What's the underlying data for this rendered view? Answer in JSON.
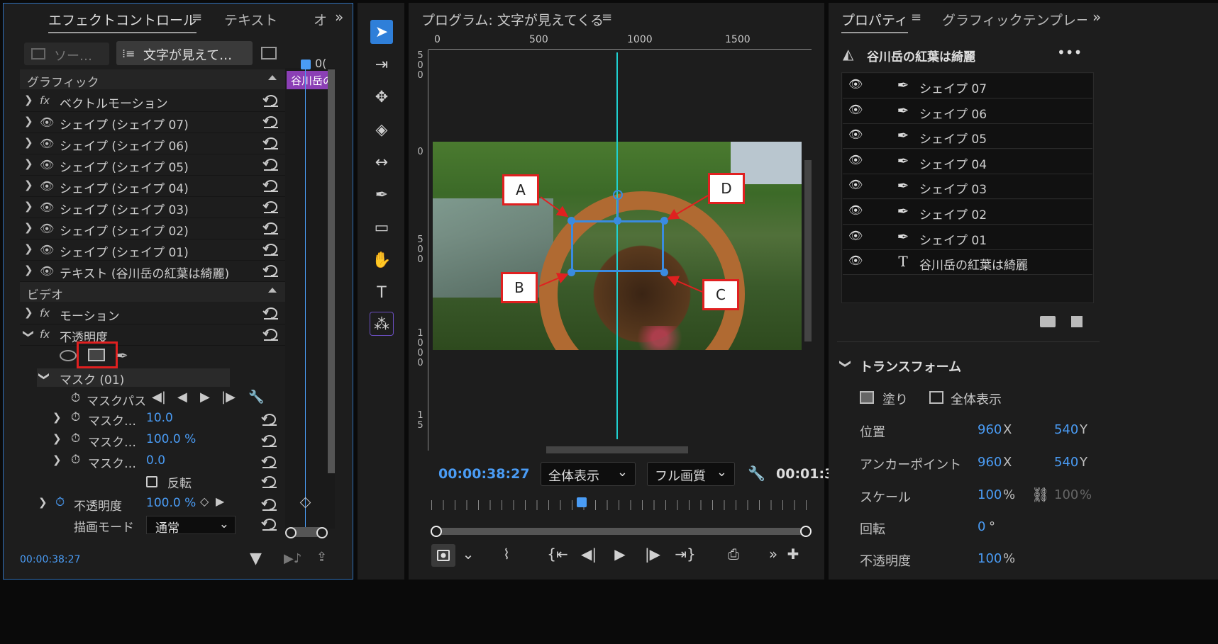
{
  "effect_controls": {
    "tabs": [
      "エフェクトコントロール",
      "テキスト",
      "オ"
    ],
    "source_label": "ソー…",
    "sequence_label": "文字が見えて…",
    "timeline_time": "0(",
    "clip_label": "谷川岳の",
    "section_graphic": "グラフィック",
    "graphic_rows": [
      {
        "icon": "fx",
        "label": "ベクトルモーション"
      },
      {
        "icon": "eye",
        "label": "シェイプ (シェイプ 07)"
      },
      {
        "icon": "eye",
        "label": "シェイプ (シェイプ 06)"
      },
      {
        "icon": "eye",
        "label": "シェイプ (シェイプ 05)"
      },
      {
        "icon": "eye",
        "label": "シェイプ (シェイプ 04)"
      },
      {
        "icon": "eye",
        "label": "シェイプ (シェイプ 03)"
      },
      {
        "icon": "eye",
        "label": "シェイプ (シェイプ 02)"
      },
      {
        "icon": "eye",
        "label": "シェイプ (シェイプ 01)"
      },
      {
        "icon": "eye",
        "label": "テキスト (谷川岳の紅葉は綺麗)"
      }
    ],
    "section_video": "ビデオ",
    "motion": "モーション",
    "opacity": "不透明度",
    "mask": "マスク (01)",
    "mask_path": "マスクパス",
    "mask_props": [
      {
        "label": "マスク…",
        "value": "10.0"
      },
      {
        "label": "マスク…",
        "value": "100.0 %"
      },
      {
        "label": "マスク…",
        "value": "0.0"
      }
    ],
    "invert": "反転",
    "opacity_label": "不透明度",
    "opacity_value": "100.0 %",
    "blend_label": "描画モード",
    "blend_value": "通常",
    "timecode": "00:00:38:27"
  },
  "program": {
    "title": "プログラム: 文字が見えてくる",
    "ruler": [
      "0",
      "500",
      "1000",
      "1500"
    ],
    "callouts": {
      "a": "A",
      "b": "B",
      "c": "C",
      "d": "D"
    },
    "timecode": "00:00:38:27",
    "fit": "全体表示",
    "quality": "フル画質",
    "duration": "00:01:3"
  },
  "properties": {
    "tabs": [
      "プロパティ",
      "グラフィックテンプレート"
    ],
    "title": "谷川岳の紅葉は綺麗",
    "layers": [
      {
        "icon": "pen",
        "label": "シェイプ 07"
      },
      {
        "icon": "pen",
        "label": "シェイプ 06"
      },
      {
        "icon": "pen",
        "label": "シェイプ 05"
      },
      {
        "icon": "pen",
        "label": "シェイプ 04"
      },
      {
        "icon": "pen",
        "label": "シェイプ 03"
      },
      {
        "icon": "pen",
        "label": "シェイプ 02"
      },
      {
        "icon": "pen",
        "label": "シェイプ 01"
      },
      {
        "icon": "text",
        "label": "谷川岳の紅葉は綺麗"
      }
    ],
    "transform": "トランスフォーム",
    "fill": "塗り",
    "fit_all": "全体表示",
    "position": {
      "label": "位置",
      "x": "960",
      "y": "540"
    },
    "anchor": {
      "label": "アンカーポイント",
      "x": "960",
      "y": "540"
    },
    "scale": {
      "label": "スケール",
      "value": "100",
      "value2": "100"
    },
    "rotation": {
      "label": "回転",
      "value": "0"
    },
    "opacity": {
      "label": "不透明度",
      "value": "100"
    },
    "unit_x": "X",
    "unit_y": "Y",
    "unit_pct": "%",
    "unit_deg": "°"
  },
  "colors": {
    "accent": "#4a9cf5",
    "highlight": "#e02020",
    "clip": "#8b3fb5"
  }
}
